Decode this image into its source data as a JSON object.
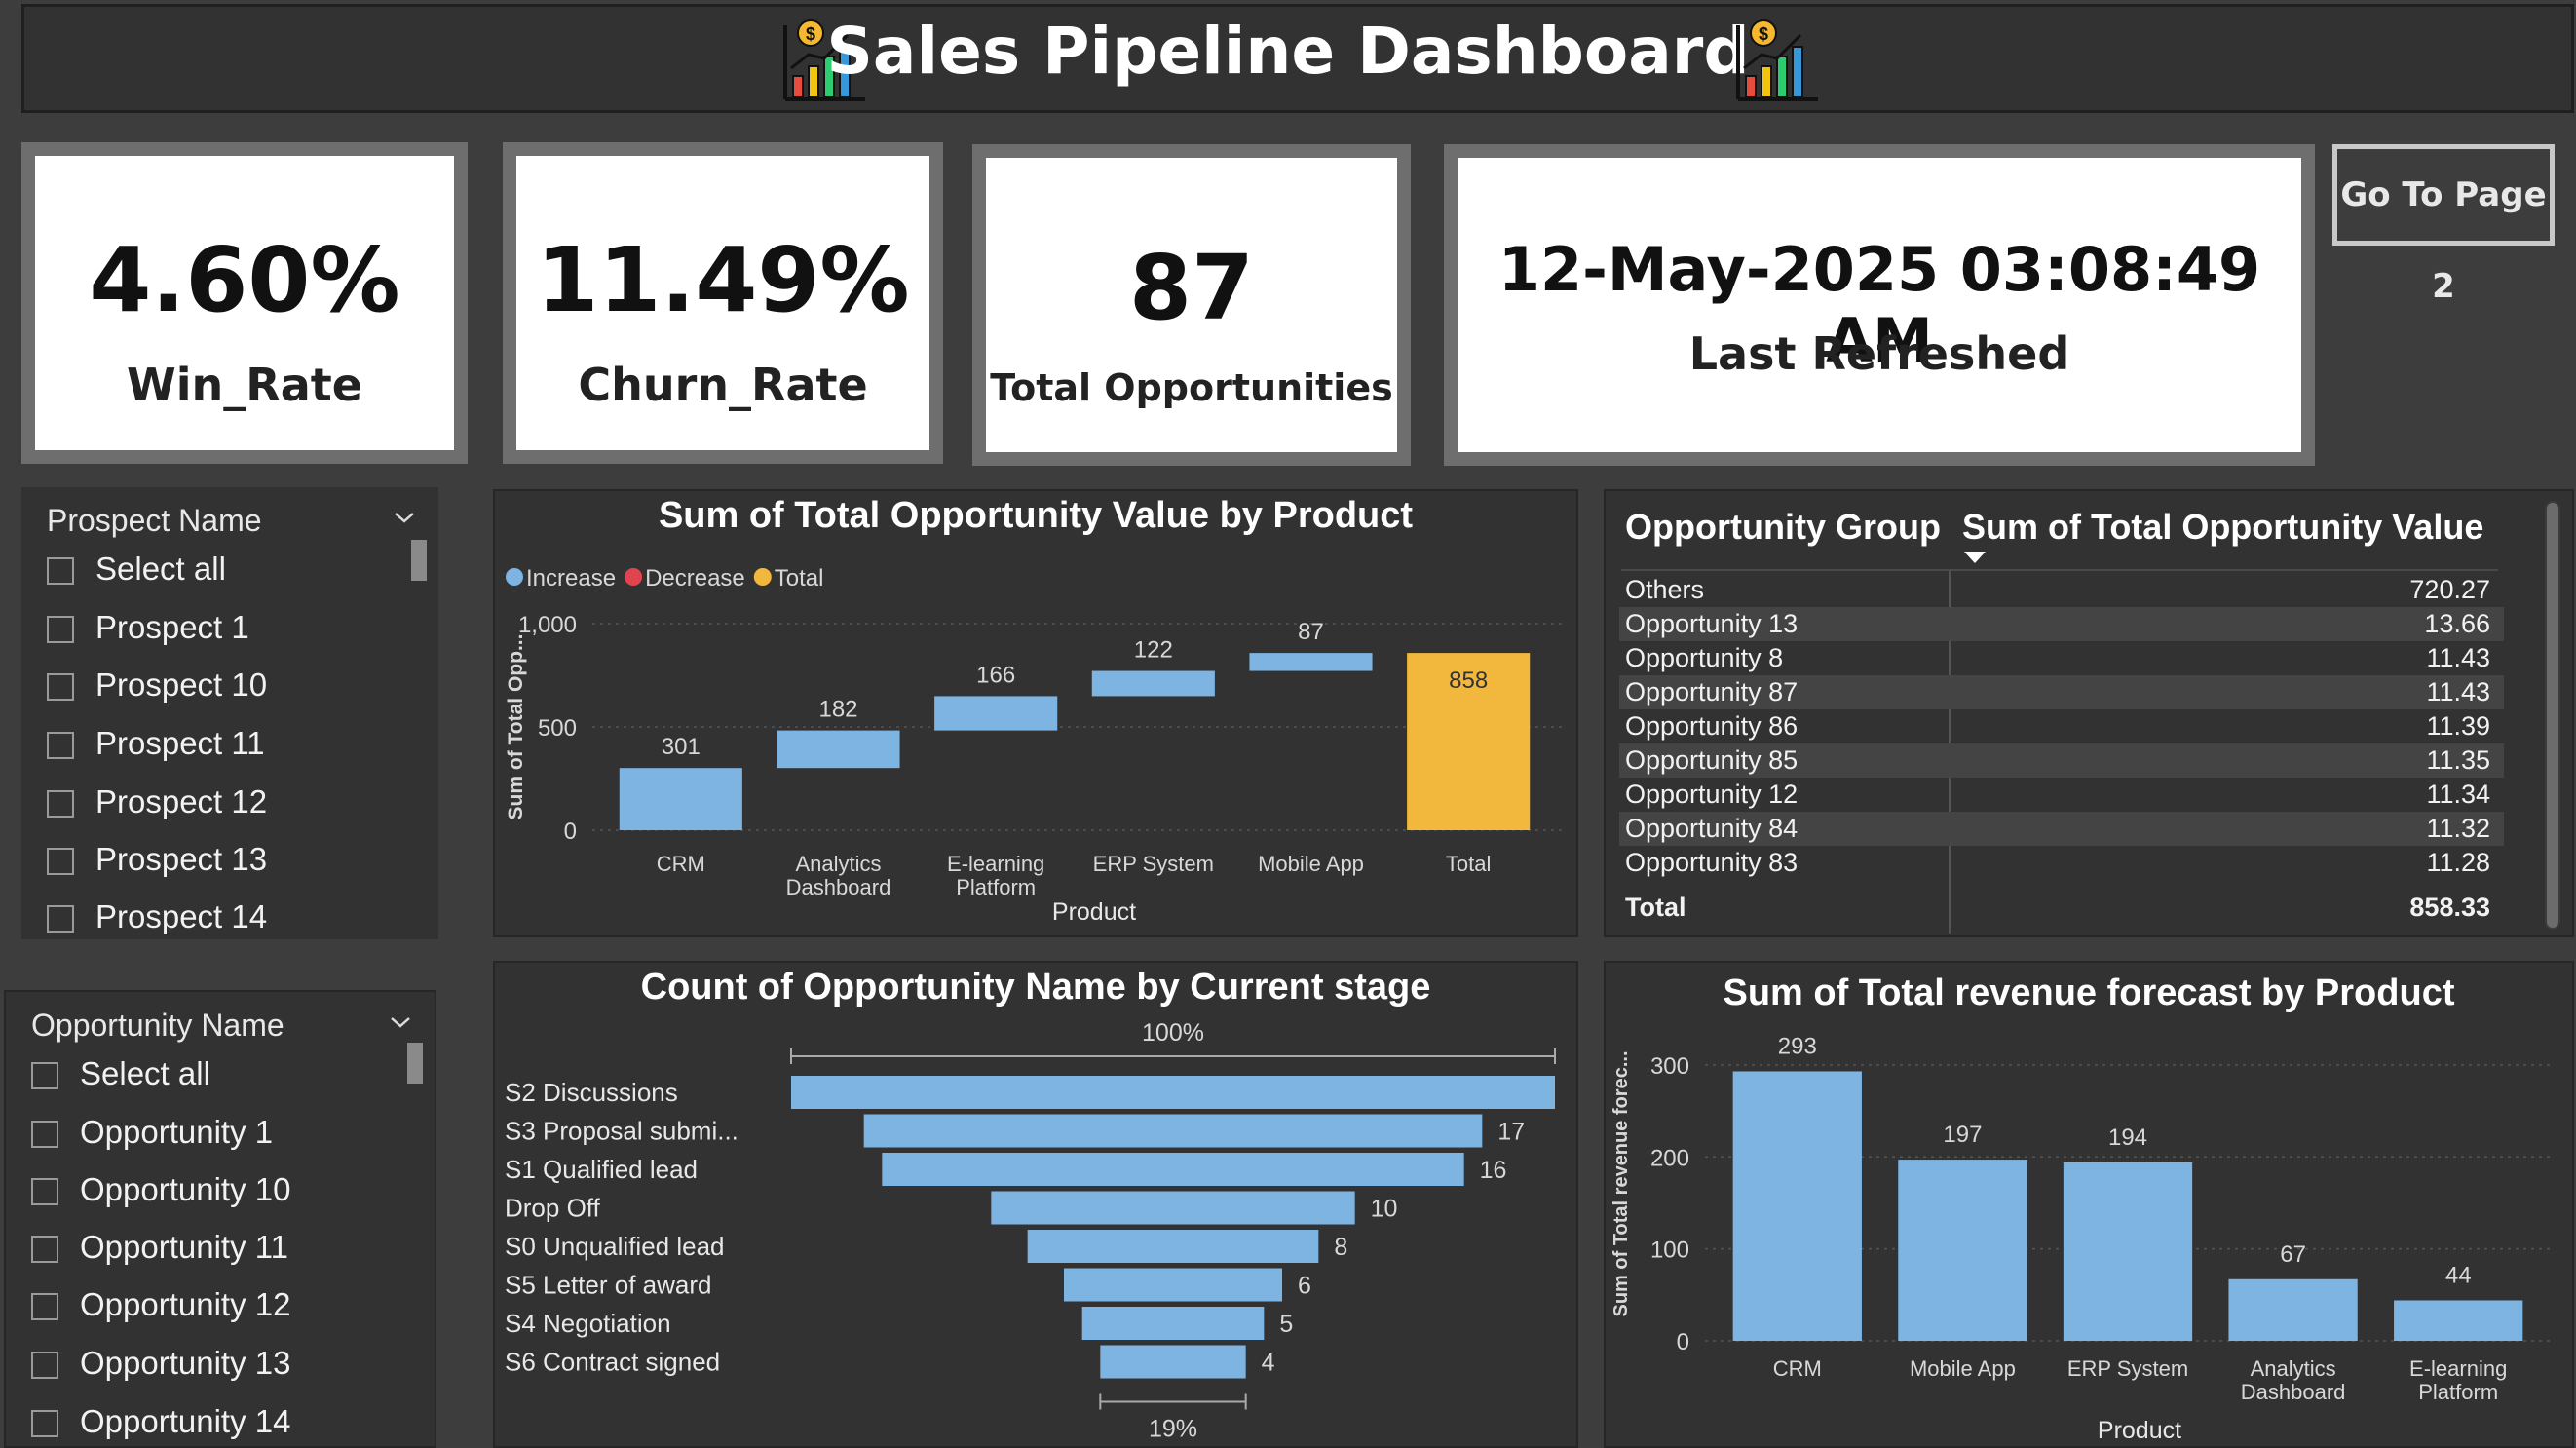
{
  "header": {
    "title": "Sales Pipeline Dashboard",
    "icon": "chart-growth-icon"
  },
  "kpis": {
    "win_rate": {
      "value": "4.60%",
      "label": "Win_Rate"
    },
    "churn_rate": {
      "value": "11.49%",
      "label": "Churn_Rate"
    },
    "total_opps": {
      "value": "87",
      "label": "Total Opportunities"
    },
    "refreshed": {
      "value": "12-May-2025 03:08:49 AM",
      "label": "Last Refreshed"
    }
  },
  "nav": {
    "goto_label": "Go To Page 2"
  },
  "prospect_slicer": {
    "header": "Prospect Name",
    "items": [
      "Select all",
      "Prospect 1",
      "Prospect 10",
      "Prospect 11",
      "Prospect 12",
      "Prospect 13",
      "Prospect 14"
    ]
  },
  "opportunity_slicer": {
    "header": "Opportunity Name",
    "items": [
      "Select all",
      "Opportunity 1",
      "Opportunity 10",
      "Opportunity 11",
      "Opportunity 12",
      "Opportunity 13",
      "Opportunity 14"
    ]
  },
  "opp_table": {
    "headers": [
      "Opportunity Group",
      "Sum of Total Opportunity Value"
    ],
    "rows": [
      [
        "Others",
        "720.27"
      ],
      [
        "Opportunity 13",
        "13.66"
      ],
      [
        "Opportunity 8",
        "11.43"
      ],
      [
        "Opportunity 87",
        "11.43"
      ],
      [
        "Opportunity 86",
        "11.39"
      ],
      [
        "Opportunity 85",
        "11.35"
      ],
      [
        "Opportunity 12",
        "11.34"
      ],
      [
        "Opportunity 84",
        "11.32"
      ],
      [
        "Opportunity 83",
        "11.28"
      ]
    ],
    "total": [
      "Total",
      "858.33"
    ]
  },
  "colors": {
    "bar": "#7eb4e2",
    "decrease": "#e0454f",
    "total": "#f2b73d",
    "panel": "#323232"
  },
  "chart_data": [
    {
      "type": "bar",
      "subtype": "waterfall",
      "title": "Sum of Total Opportunity Value by Product",
      "xlabel": "Product",
      "ylabel": "Sum of Total Opp...",
      "legend": [
        "Increase",
        "Decrease",
        "Total"
      ],
      "legend_position": "top-left",
      "categories": [
        "CRM",
        "Analytics Dashboard",
        "E-learning Platform",
        "ERP System",
        "Mobile App",
        "Total"
      ],
      "values": [
        301,
        182,
        166,
        122,
        87,
        858
      ],
      "ylim": [
        0,
        1000
      ],
      "yticks": [
        "0",
        "500",
        "1,000"
      ],
      "grid": true
    },
    {
      "type": "bar",
      "subtype": "funnel",
      "title": "Count of Opportunity Name by Current stage",
      "categories": [
        "S2 Discussions",
        "S3 Proposal submi...",
        "S1 Qualified lead",
        "Drop Off",
        "S0 Unqualified lead",
        "S5 Letter of award",
        "S4 Negotiation",
        "S6 Contract signed"
      ],
      "values": [
        21,
        17,
        16,
        10,
        8,
        6,
        5,
        4
      ],
      "value_labels": [
        "",
        "17",
        "16",
        "10",
        "8",
        "6",
        "5",
        "4"
      ],
      "top_percent": "100%",
      "bottom_percent": "19%"
    },
    {
      "type": "bar",
      "title": "Sum of Total revenue forecast by Product",
      "xlabel": "Product",
      "ylabel": "Sum of Total revenue forec...",
      "categories": [
        "CRM",
        "Mobile App",
        "ERP System",
        "Analytics Dashboard",
        "E-learning Platform"
      ],
      "values": [
        293,
        197,
        194,
        67,
        44
      ],
      "ylim": [
        0,
        320
      ],
      "yticks": [
        "0",
        "100",
        "200",
        "300"
      ],
      "grid": true
    }
  ]
}
